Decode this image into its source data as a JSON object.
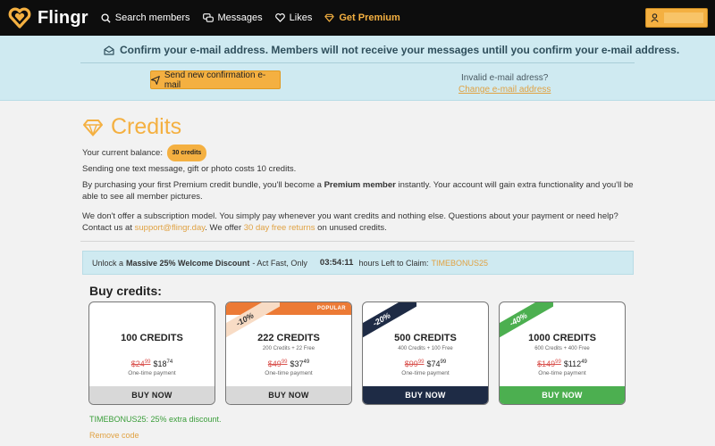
{
  "brand": {
    "name": "Flingr"
  },
  "nav": {
    "items": [
      {
        "label": "Search members",
        "icon": "search-icon"
      },
      {
        "label": "Messages",
        "icon": "chat-icon"
      },
      {
        "label": "Likes",
        "icon": "heart-icon"
      },
      {
        "label": "Get Premium",
        "icon": "diamond-icon"
      }
    ]
  },
  "confirm": {
    "message": "Confirm your e-mail address. Members will not receive your messages untill you confirm your e-mail address.",
    "send_button": "Send new confirmation e-mail",
    "invalid_text": "Invalid e-mail adress?",
    "change_link": "Change e-mail address"
  },
  "credits": {
    "title": "Credits",
    "balance_label": "Your current balance:",
    "balance_badge": "30 credits",
    "cost_text": "Sending one text message, gift or photo costs 10 credits.",
    "premium_before": "By purchasing your first Premium credit bundle, you'll become a ",
    "premium_bold": "Premium member",
    "premium_after": " instantly. Your account will gain extra functionality and you'll be able to see all member pictures.",
    "subscription_text": "We don't offer a subscription model. You simply pay whenever you want credits and nothing else. Questions about your payment or need help? Contact us at",
    "support_email": "support@flingr.day",
    "offer_text": ". We offer",
    "returns_link": "30 day free returns",
    "returns_after": "on unused credits."
  },
  "discount": {
    "prefix": "Unlock a",
    "bold": "Massive 25% Welcome Discount",
    "suffix": "- Act Fast, Only",
    "timer": "03:54:11",
    "timer_suffix": "hours Left to Claim:",
    "code": "TIMEBONUS25"
  },
  "buy": {
    "heading": "Buy credits:",
    "cards": [
      {
        "name": "100 CREDITS",
        "sub": "",
        "old_main": "$24",
        "old_cents": "99",
        "new_main": "$18",
        "new_cents": "74",
        "period": "One-time payment",
        "button": "BUY NOW",
        "ribbon": "",
        "tag": ""
      },
      {
        "name": "222 CREDITS",
        "sub": "200 Credits + 22 Free",
        "old_main": "$49",
        "old_cents": "99",
        "new_main": "$37",
        "new_cents": "49",
        "period": "One-time payment",
        "button": "BUY NOW",
        "ribbon": "-10%",
        "tag": "POPULAR"
      },
      {
        "name": "500 CREDITS",
        "sub": "400 Credits + 100 Free",
        "old_main": "$99",
        "old_cents": "99",
        "new_main": "$74",
        "new_cents": "99",
        "period": "One-time payment",
        "button": "BUY NOW",
        "ribbon": "-20%",
        "tag": ""
      },
      {
        "name": "1000 CREDITS",
        "sub": "600 Credits + 400 Free",
        "old_main": "$149",
        "old_cents": "99",
        "new_main": "$112",
        "new_cents": "49",
        "period": "One-time payment",
        "button": "BUY NOW",
        "ribbon": "-40%",
        "tag": ""
      }
    ],
    "applied_text": "TIMEBONUS25: 25% extra discount.",
    "remove_text": "Remove code"
  },
  "colors": {
    "accent": "#f4b041",
    "banner": "#cfeaf1",
    "popular": "#ec7a35",
    "navy": "#1e2b45",
    "green": "#4caf50",
    "strike": "#d9534f"
  }
}
